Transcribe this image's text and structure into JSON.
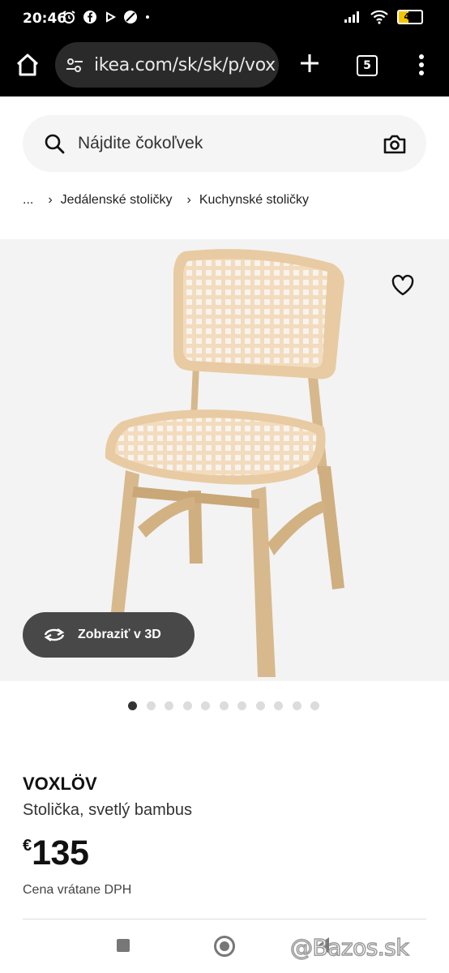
{
  "status_bar": {
    "time": "20:46",
    "battery": "43",
    "left_icons": [
      "alarm-icon",
      "facebook-icon",
      "play-icon",
      "circle-slash-icon",
      "dot-icon"
    ],
    "right_icons": [
      "signal-icon",
      "wifi-icon",
      "battery-icon"
    ]
  },
  "browser": {
    "url": "ikea.com/sk/sk/p/vox",
    "tab_count": "5"
  },
  "search": {
    "placeholder": "Nájdite čokoľvek"
  },
  "breadcrumb": {
    "items": [
      "...",
      "Jedálenské stoličky",
      "Kuchynské stoličky"
    ]
  },
  "product": {
    "view_3d_label": "Zobraziť v 3D",
    "image_count": 11,
    "active_image": 1,
    "name": "VOXLÖV",
    "description": "Stolička, svetlý bambus",
    "currency": "€",
    "price": "135",
    "vat_note": "Cena vrátane DPH"
  },
  "watermark": "@Bazos.sk",
  "colors": {
    "status_bg": "#000000",
    "url_bg": "#2a2a2a",
    "search_bg": "#f5f5f5",
    "button_3d_bg": "#484848",
    "battery": "#f5c400"
  }
}
